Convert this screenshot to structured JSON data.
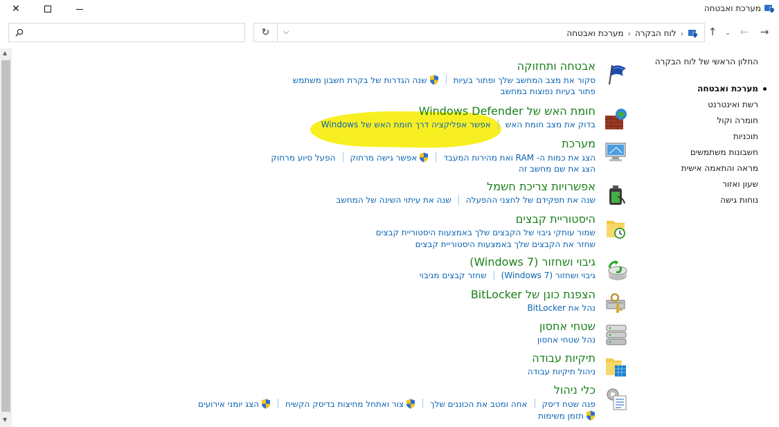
{
  "window": {
    "title": "מערכת ואבטחה"
  },
  "addressbar": {
    "crumbs": [
      "לוח הבקרה",
      "מערכת ואבטחה"
    ]
  },
  "sidebar": {
    "home": "החלון הראשי של לוח הבקרה",
    "items": [
      {
        "label": "מערכת ואבטחה",
        "current": true
      },
      {
        "label": "רשת ואינטרנט"
      },
      {
        "label": "חומרה וקול"
      },
      {
        "label": "תוכניות"
      },
      {
        "label": "חשבונות משתמשים"
      },
      {
        "label": "מראה והתאמה אישית"
      },
      {
        "label": "שעון ואזור"
      },
      {
        "label": "נוחות גישה"
      }
    ]
  },
  "categories": [
    {
      "title": "אבטחה ותחזוקה",
      "icon": "security-flag-icon",
      "rows": [
        [
          {
            "t": "סקור את מצב המחשב שלך ופתור בעיות"
          },
          {
            "t": "שנה הגדרות של בקרת חשבון משתמש",
            "shield": true
          }
        ],
        [
          {
            "t": "פתור בעיות נפוצות במחשב"
          }
        ]
      ]
    },
    {
      "title": "חומת האש של Windows Defender",
      "icon": "firewall-icon",
      "rows": [
        [
          {
            "t": "בדוק את מצב חומת האש"
          },
          {
            "t": "אפשר אפליקציה דרך חומת האש של Windows"
          }
        ]
      ]
    },
    {
      "title": "מערכת",
      "icon": "system-computer-icon",
      "rows": [
        [
          {
            "t": "הצג את כמות ה- RAM ואת מהירות המעבד"
          },
          {
            "t": "אפשר גישה מרחוק",
            "shield": true
          },
          {
            "t": "הפעל סיוע מרחוק"
          }
        ],
        [
          {
            "t": "הצג את שם מחשב זה"
          }
        ]
      ]
    },
    {
      "title": "אפשרויות צריכת חשמל",
      "icon": "power-options-icon",
      "rows": [
        [
          {
            "t": "שנה את תפקידם של לחצני ההפעלה"
          },
          {
            "t": "שנה את עיתוי השינה של המחשב"
          }
        ]
      ]
    },
    {
      "title": "היסטוריית קבצים",
      "icon": "file-history-icon",
      "rows": [
        [
          {
            "t": "שמור עותקי גיבוי של הקבצים שלך באמצעות היסטוריית קבצים"
          }
        ],
        [
          {
            "t": "שחזר את הקבצים שלך באמצעות היסטוריית קבצים"
          }
        ]
      ]
    },
    {
      "title": "גיבוי ושחזור (Windows 7)",
      "icon": "backup-restore-icon",
      "rows": [
        [
          {
            "t": "גיבוי ושחזור (Windows 7)"
          },
          {
            "t": "שחזר קבצים מגיבוי"
          }
        ]
      ]
    },
    {
      "title": "הצפנת כונן של BitLocker",
      "icon": "bitlocker-icon",
      "rows": [
        [
          {
            "t": "נהל את BitLocker"
          }
        ]
      ]
    },
    {
      "title": "שטחי אחסון",
      "icon": "storage-spaces-icon",
      "rows": [
        [
          {
            "t": "נהל שטחי אחסון"
          }
        ]
      ]
    },
    {
      "title": "תיקיות עבודה",
      "icon": "work-folders-icon",
      "rows": [
        [
          {
            "t": "ניהול תיקיות עבודה"
          }
        ]
      ]
    },
    {
      "title": "כלי ניהול",
      "icon": "admin-tools-icon",
      "rows": [
        [
          {
            "t": "פנה שטח דיסק"
          },
          {
            "t": "אחה ומטב את הכוננים שלך"
          },
          {
            "t": "צור ואתחל מחיצות בדיסק הקשיח",
            "shield": true
          },
          {
            "t": "הצג יומני אירועים",
            "shield": true
          }
        ],
        [
          {
            "t": "תזמן משימות",
            "shield": true
          }
        ]
      ]
    }
  ]
}
